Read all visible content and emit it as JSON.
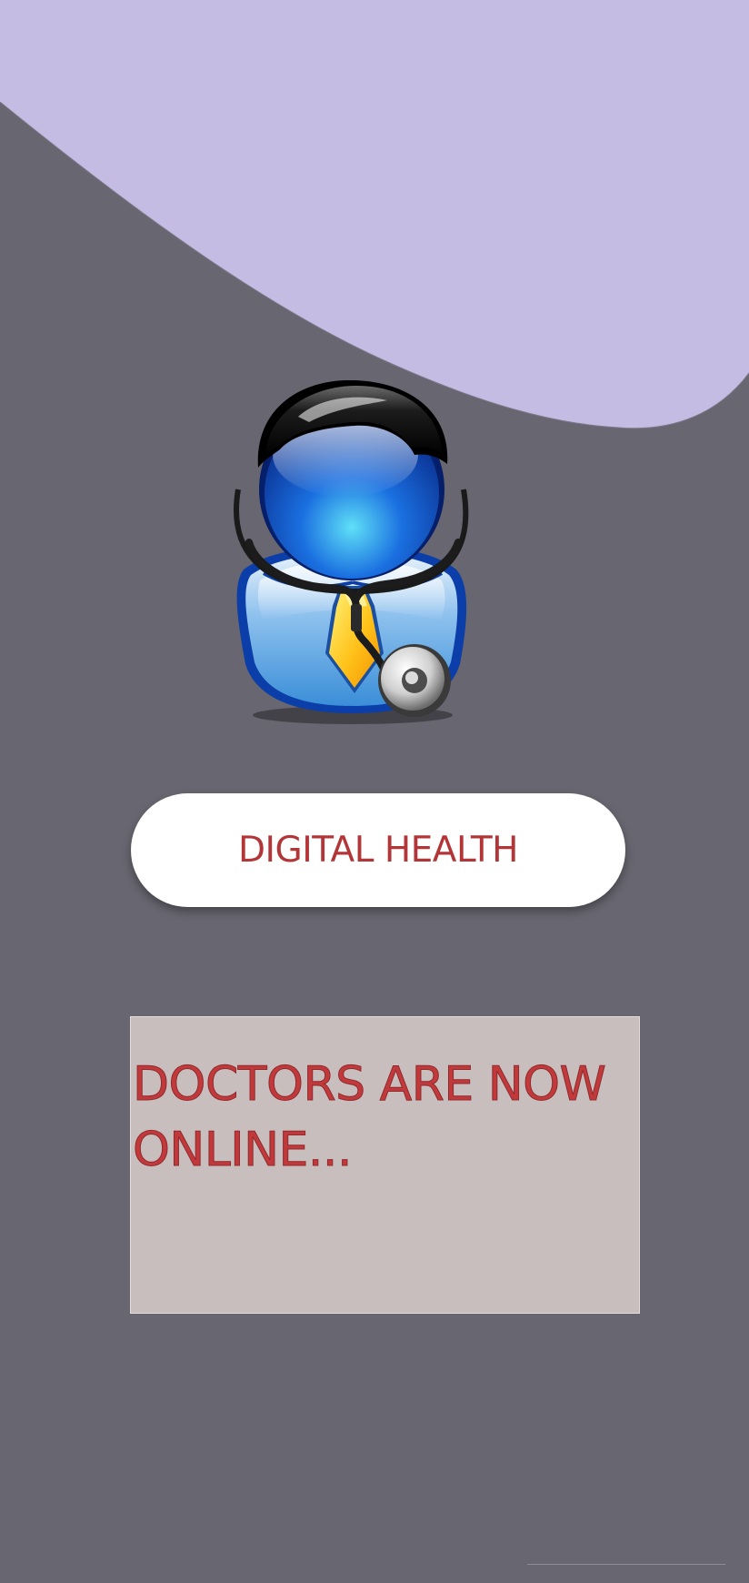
{
  "app": {
    "title_button_label": "DIGITAL HEALTH",
    "status_message": "DOCTORS ARE NOW ONLINE..."
  },
  "colors": {
    "background": "#686670",
    "wave": "#c5bce3",
    "button_background": "#ffffff",
    "accent_red": "#b23638",
    "card_background": "#c8bebe"
  },
  "icons": {
    "avatar": "doctor-avatar-icon"
  }
}
